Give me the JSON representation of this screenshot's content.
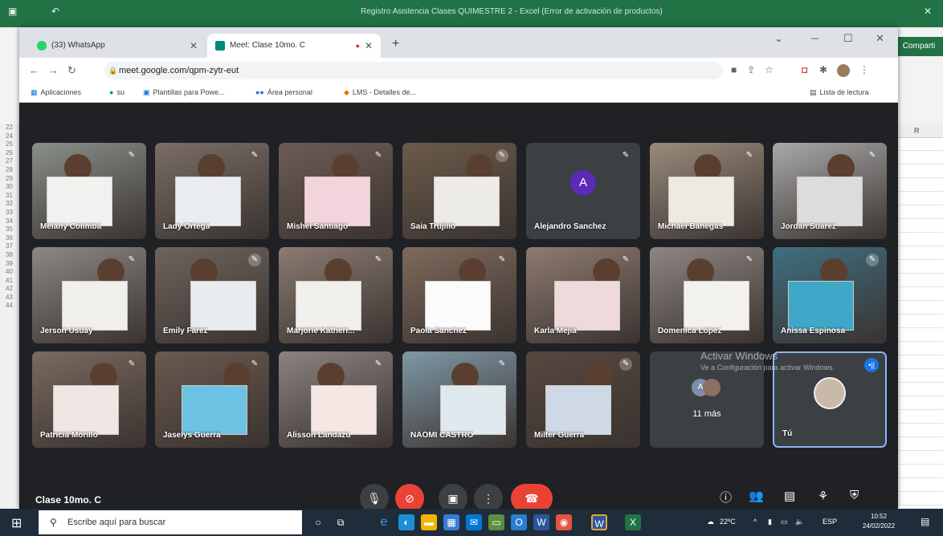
{
  "excel": {
    "title": "Registro Asistencia Clases QUIMESTRE 2 - Excel (Error de activación de productos)",
    "share_label": "Comparti",
    "col_header": "R",
    "row_numbers": [
      "22",
      "24",
      "25",
      "26",
      "27",
      "28",
      "29",
      "30",
      "31",
      "32",
      "33",
      "34",
      "35",
      "36",
      "37",
      "38",
      "39",
      "40",
      "41",
      "42",
      "43",
      "44"
    ]
  },
  "browser": {
    "tabs": [
      {
        "label": "(33) WhatsApp",
        "active": false
      },
      {
        "label": "Meet: Clase 10mo. C",
        "active": true
      }
    ],
    "url": "meet.google.com/qpm-zytr-eut",
    "bookmarks": [
      "Aplicaciones",
      "su",
      "Plantillas para Powe...",
      "Área personal",
      "LMS - Detalles de..."
    ],
    "reading_list": "Lista de lectura"
  },
  "meet": {
    "meeting_name": "Clase 10mo. C",
    "participants": [
      {
        "name": "Melany Collmba",
        "kind": "video"
      },
      {
        "name": "Lady Ortega",
        "kind": "video"
      },
      {
        "name": "Mishel Santiago",
        "kind": "video"
      },
      {
        "name": "Saia Trujillo",
        "kind": "video"
      },
      {
        "name": "Alejandro Sanchez",
        "kind": "avatar",
        "initial": "A"
      },
      {
        "name": "Michael Banegas",
        "kind": "video"
      },
      {
        "name": "Jordan Suarez",
        "kind": "video"
      },
      {
        "name": "Jerson Usuay",
        "kind": "video"
      },
      {
        "name": "Emily Farez",
        "kind": "video"
      },
      {
        "name": "Marjorie Katheri...",
        "kind": "video"
      },
      {
        "name": "Paola Sanchez",
        "kind": "video"
      },
      {
        "name": "Karla Mejía",
        "kind": "video"
      },
      {
        "name": "Domenica López",
        "kind": "video"
      },
      {
        "name": "Anissa Espinosa",
        "kind": "video"
      },
      {
        "name": "Patricia Morillo",
        "kind": "video"
      },
      {
        "name": "Jaselys Guerra",
        "kind": "video"
      },
      {
        "name": "Alisson Landazú",
        "kind": "video"
      },
      {
        "name": "NAOMI CASTRO",
        "kind": "video"
      },
      {
        "name": "Milter Guerra",
        "kind": "video"
      }
    ],
    "more": {
      "label": "11 más",
      "initial": "A"
    },
    "self": {
      "name": "Tú"
    },
    "activate_title": "Activar Windows",
    "activate_sub": "Ve a Configuración para activar Windows."
  },
  "taskbar": {
    "search_placeholder": "Escribe aquí para buscar",
    "temperature": "22ºC",
    "language": "ESP",
    "time": "10:52",
    "date": "24/02/2022"
  }
}
